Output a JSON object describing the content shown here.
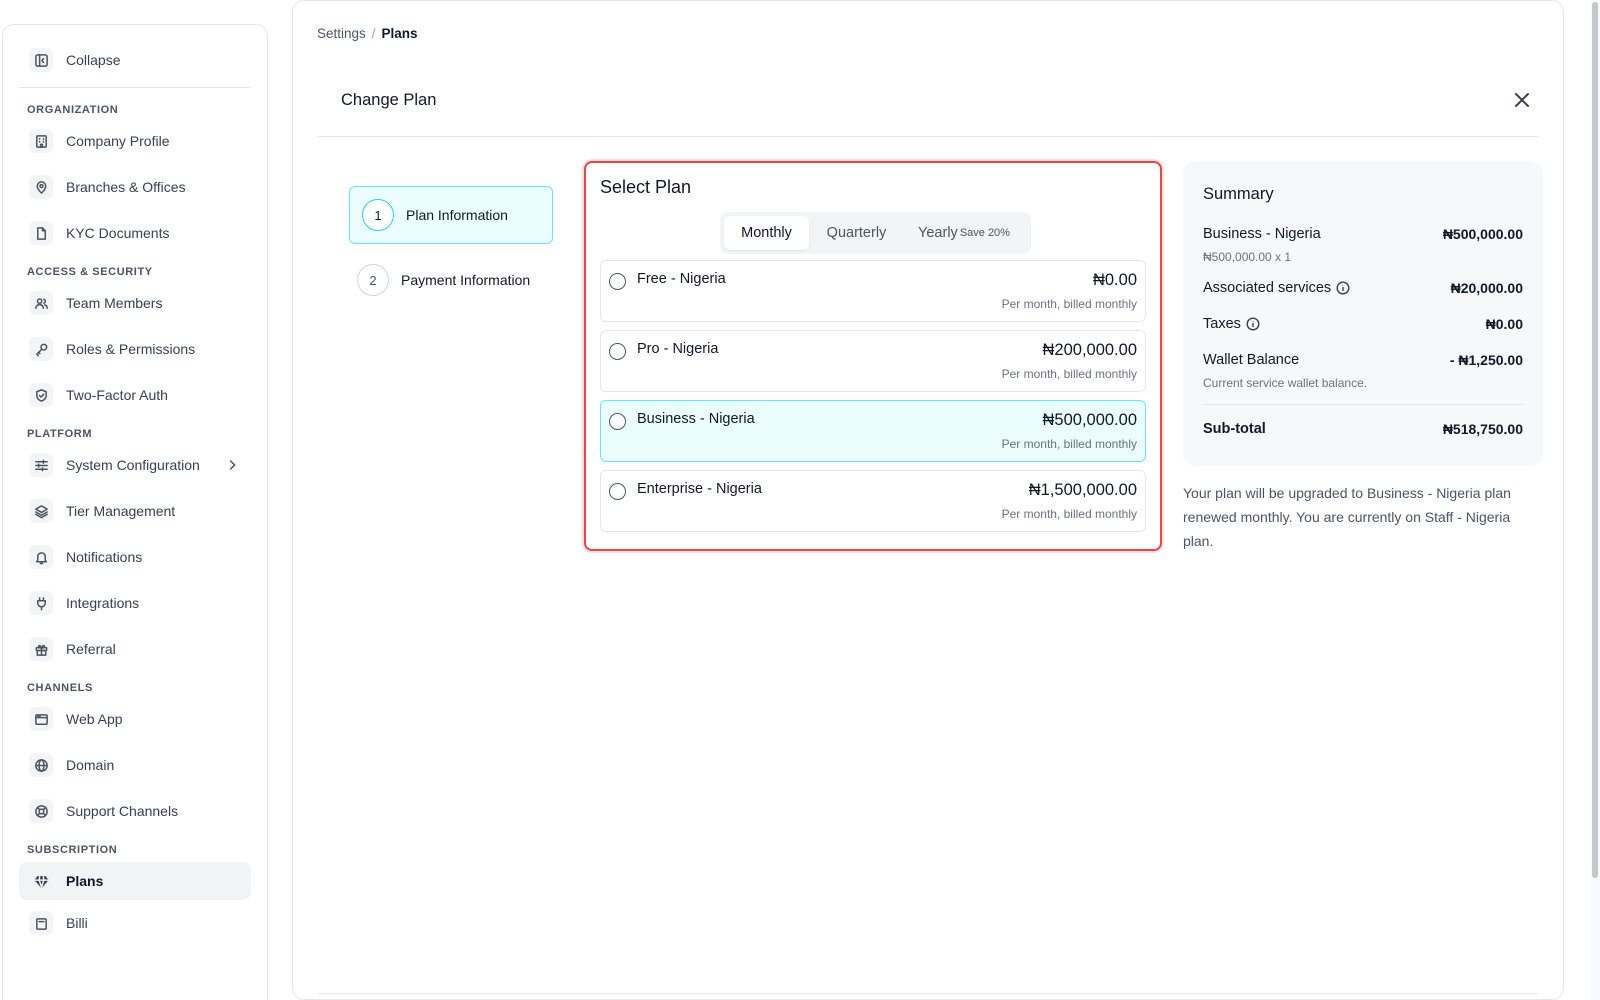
{
  "sidebar": {
    "collapse_label": "Collapse",
    "sections": {
      "organization": "ORGANIZATION",
      "access": "ACCESS & SECURITY",
      "platform": "PLATFORM",
      "channels": "CHANNELS",
      "subscription": "SUBSCRIPTION"
    },
    "items": {
      "company_profile": "Company Profile",
      "branches": "Branches & Offices",
      "kyc": "KYC Documents",
      "team": "Team Members",
      "roles": "Roles & Permissions",
      "twofa": "Two-Factor Auth",
      "system_config": "System Configuration",
      "tier": "Tier Management",
      "notifications": "Notifications",
      "integrations": "Integrations",
      "referral": "Referral",
      "web_app": "Web App",
      "domain": "Domain",
      "support": "Support Channels",
      "plans": "Plans",
      "billing": "Billi"
    }
  },
  "breadcrumb": {
    "parent": "Settings",
    "separator": "/",
    "current": "Plans"
  },
  "header": {
    "title": "Change Plan"
  },
  "steps": [
    {
      "number": "1",
      "label": "Plan Information"
    },
    {
      "number": "2",
      "label": "Payment Information"
    }
  ],
  "select_plan": {
    "title": "Select Plan",
    "tabs": {
      "monthly": "Monthly",
      "quarterly": "Quarterly",
      "yearly": "Yearly",
      "yearly_badge": "Save 20%"
    },
    "selected_tab": "Monthly",
    "plans": [
      {
        "name": "Free - Nigeria",
        "price": "₦0.00",
        "note": "Per month, billed monthly"
      },
      {
        "name": "Pro - Nigeria",
        "price": "₦200,000.00",
        "note": "Per month, billed monthly"
      },
      {
        "name": "Business - Nigeria",
        "price": "₦500,000.00",
        "note": "Per month, billed monthly"
      },
      {
        "name": "Enterprise - Nigeria",
        "price": "₦1,500,000.00",
        "note": "Per month, billed monthly"
      }
    ],
    "selected_plan": "Business - Nigeria"
  },
  "summary": {
    "title": "Summary",
    "plan_label": "Business - Nigeria",
    "plan_value": "₦500,000.00",
    "plan_sub": "₦500,000.00 x 1",
    "services_label": "Associated services",
    "services_value": "₦20,000.00",
    "taxes_label": "Taxes",
    "taxes_value": "₦0.00",
    "wallet_label": "Wallet Balance",
    "wallet_value": "- ₦1,250.00",
    "wallet_sub": "Current service wallet balance.",
    "subtotal_label": "Sub-total",
    "subtotal_value": "₦518,750.00"
  },
  "upgrade_note": "Your plan will be upgraded to Business - Nigeria plan renewed monthly. You are currently on Staff - Nigeria plan.",
  "colors": {
    "accent_cyan": "#67e8f9",
    "selected_bg": "#ecfdfd",
    "highlight_red": "#e04a4a"
  }
}
